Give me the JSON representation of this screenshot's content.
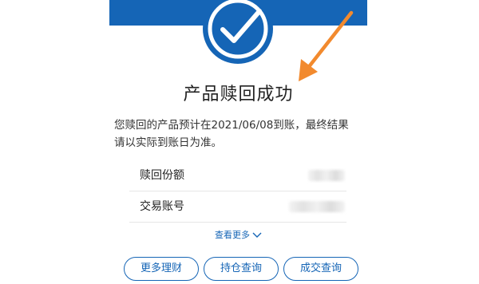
{
  "result": {
    "title": "产品赎回成功",
    "description": "您赎回的产品预计在2021/06/08到账，最终结果请以实际到账日为准。"
  },
  "details": [
    {
      "label": "赎回份额"
    },
    {
      "label": "交易账号"
    }
  ],
  "see_more_label": "查看更多",
  "actions": {
    "more_finance": "更多理财",
    "positions_query": "持仓查询",
    "trades_query": "成交查询"
  },
  "colors": {
    "brand_blue": "#1565b6",
    "annotation_arrow": "#f28a2e"
  },
  "icons": {
    "success": "check-circle-icon",
    "see_more": "chevron-down-icon",
    "annotation": "arrow-icon"
  }
}
